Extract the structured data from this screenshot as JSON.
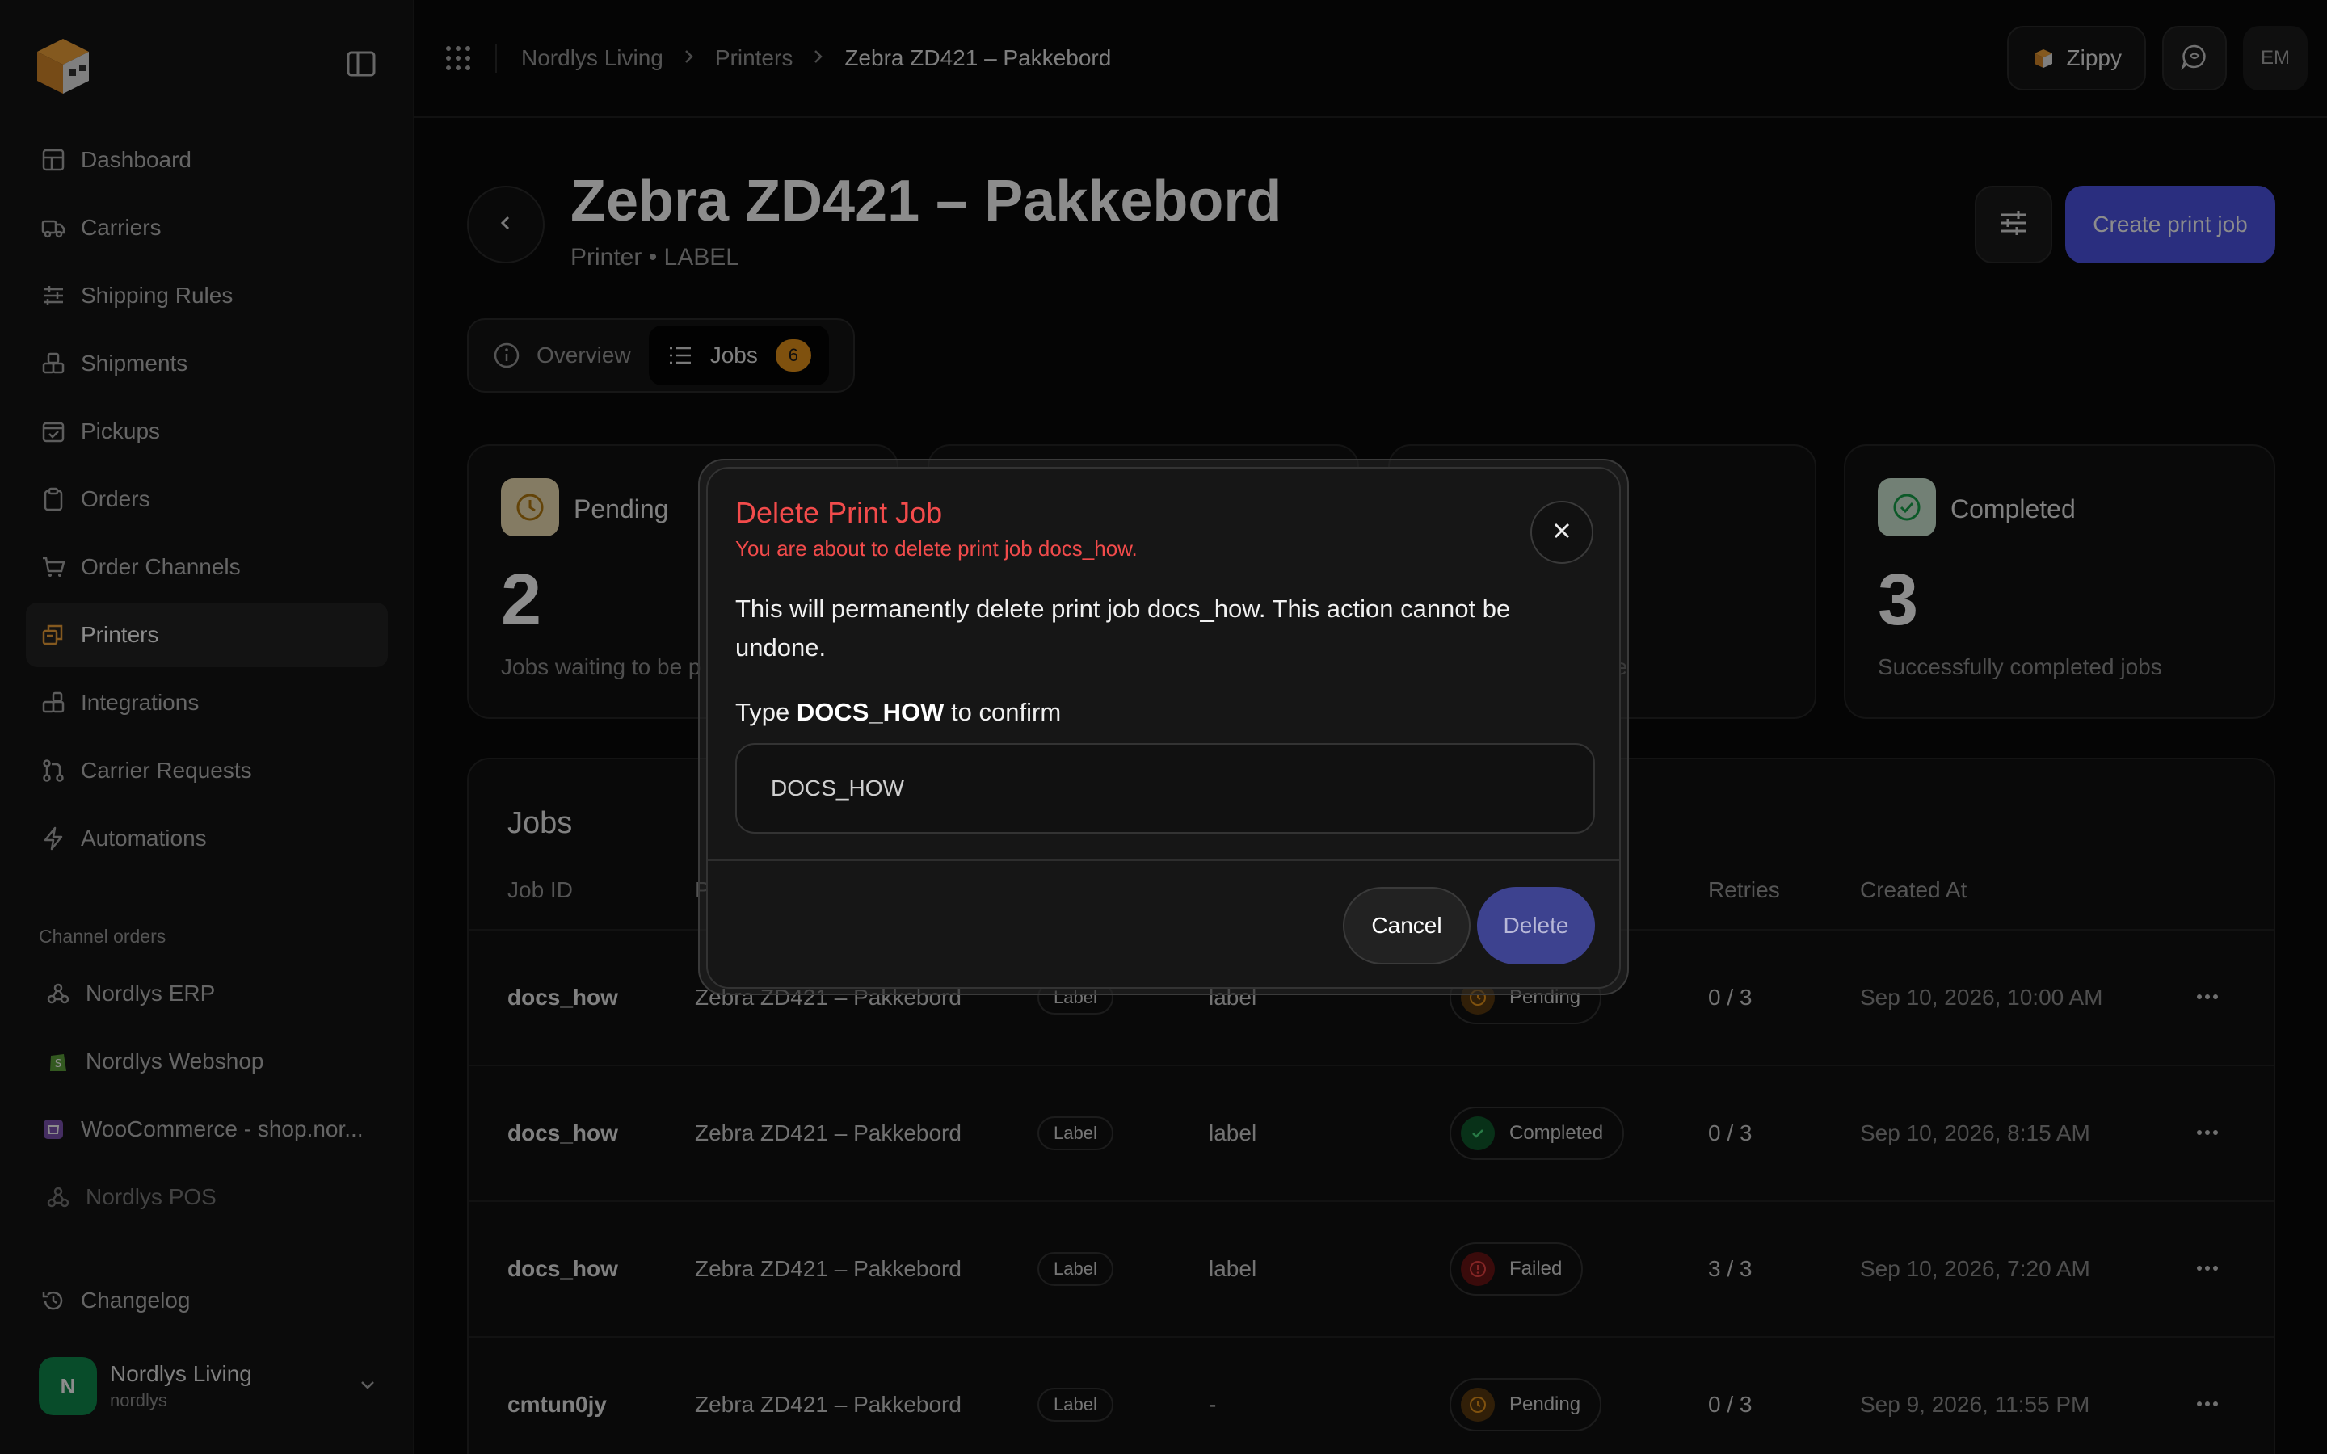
{
  "sidebar": {
    "nav": [
      {
        "label": "Dashboard",
        "icon": "dashboard-icon"
      },
      {
        "label": "Carriers",
        "icon": "truck-icon"
      },
      {
        "label": "Shipping Rules",
        "icon": "sliders-icon"
      },
      {
        "label": "Shipments",
        "icon": "boxes-icon"
      },
      {
        "label": "Pickups",
        "icon": "calendar-check-icon"
      },
      {
        "label": "Orders",
        "icon": "clipboard-icon"
      },
      {
        "label": "Order Channels",
        "icon": "cart-icon"
      },
      {
        "label": "Printers",
        "icon": "printer-icon",
        "active": true
      },
      {
        "label": "Integrations",
        "icon": "blocks-icon"
      },
      {
        "label": "Carrier Requests",
        "icon": "git-pull-icon"
      },
      {
        "label": "Automations",
        "icon": "bolt-icon"
      }
    ],
    "section_label": "Channel orders",
    "channels": [
      {
        "label": "Nordlys ERP",
        "icon": "webhook-icon"
      },
      {
        "label": "Nordlys Webshop",
        "icon": "shopify-icon"
      },
      {
        "label": "WooCommerce - shop.nor...",
        "icon": "woocommerce-icon"
      },
      {
        "label": "Nordlys POS",
        "icon": "webhook-icon"
      }
    ],
    "changelog": "Changelog",
    "user": {
      "initial": "N",
      "name": "Nordlys Living",
      "handle": "nordlys"
    }
  },
  "topbar": {
    "breadcrumbs": [
      "Nordlys Living",
      "Printers",
      "Zebra ZD421 – Pakkebord"
    ],
    "zippy": "Zippy",
    "user_initials": "EM"
  },
  "page": {
    "title": "Zebra ZD421 – Pakkebord",
    "subtitle": "Printer • LABEL",
    "create_button": "Create print job",
    "tabs": {
      "overview": "Overview",
      "jobs": "Jobs",
      "jobs_count": "6"
    }
  },
  "stats": [
    {
      "label": "Pending",
      "value": "2",
      "desc": "Jobs waiting to be p"
    },
    {
      "label": "",
      "value": "",
      "desc": ""
    },
    {
      "label": "",
      "value": "",
      "desc": "mplete"
    },
    {
      "label": "Completed",
      "value": "3",
      "desc": "Successfully completed jobs"
    }
  ],
  "jobs": {
    "title": "Jobs",
    "headers": [
      "Job ID",
      "P",
      "Retries",
      "Created At"
    ],
    "rows": [
      {
        "id": "docs_how",
        "printer": "Zebra ZD421 – Pakkebord",
        "type": "Label",
        "format": "label",
        "status": "Pending",
        "retries": "0 / 3",
        "created": "Sep 10, 2026, 10:00 AM"
      },
      {
        "id": "docs_how",
        "printer": "Zebra ZD421 – Pakkebord",
        "type": "Label",
        "format": "label",
        "status": "Completed",
        "retries": "0 / 3",
        "created": "Sep 10, 2026, 8:15 AM"
      },
      {
        "id": "docs_how",
        "printer": "Zebra ZD421 – Pakkebord",
        "type": "Label",
        "format": "label",
        "status": "Failed",
        "retries": "3 / 3",
        "created": "Sep 10, 2026, 7:20 AM"
      },
      {
        "id": "cmtun0jy",
        "printer": "Zebra ZD421 – Pakkebord",
        "type": "Label",
        "format": "-",
        "status": "Pending",
        "retries": "0 / 3",
        "created": "Sep 9, 2026, 11:55 PM"
      }
    ]
  },
  "modal": {
    "title": "Delete Print Job",
    "subtitle": "You are about to delete print job docs_how.",
    "body": "This will permanently delete print job docs_how. This action cannot be undone.",
    "type_prefix": "Type",
    "type_code": "DOCS_HOW",
    "type_suffix": "to confirm",
    "input_value": "DOCS_HOW",
    "cancel": "Cancel",
    "delete": "Delete"
  },
  "colors": {
    "accent": "#4d54e8",
    "danger": "#f24b4b",
    "pending": "#e8941a",
    "completed": "#16a34a",
    "failed": "#dc2626"
  }
}
